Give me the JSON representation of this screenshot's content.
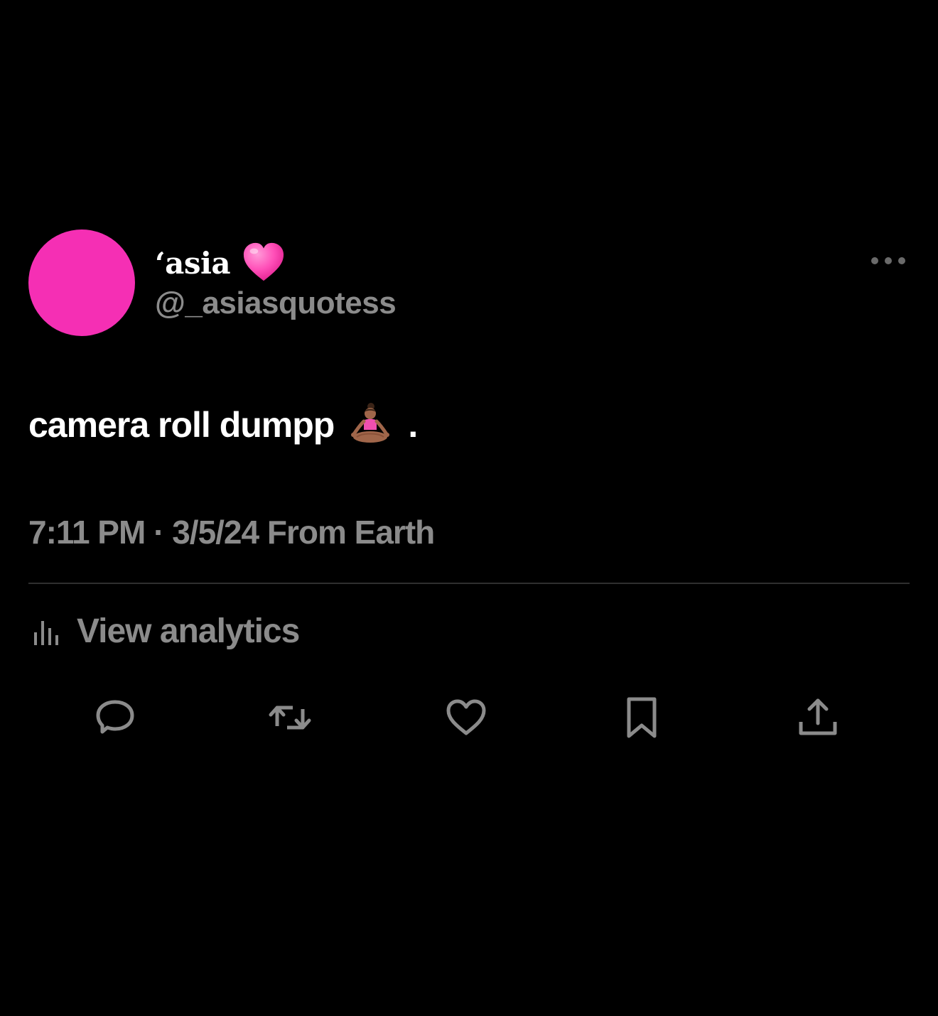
{
  "user": {
    "display_name": "‘asia",
    "name_emoji": "pink-heart-icon",
    "handle": "@_asiasquotess",
    "avatar_color": "#f52fb4"
  },
  "tweet": {
    "text": "camera roll dumpp",
    "emoji": "person-in-lotus-position-icon",
    "trailing": ".",
    "time": "7:11 PM",
    "separator": "·",
    "date": "3/5/24",
    "source": "From Earth"
  },
  "analytics": {
    "label": "View analytics",
    "icon": "analytics-bar-icon"
  },
  "actions": [
    {
      "name": "reply",
      "icon": "comment-bubble-icon"
    },
    {
      "name": "retweet",
      "icon": "retweet-icon"
    },
    {
      "name": "like",
      "icon": "heart-icon"
    },
    {
      "name": "bookmark",
      "icon": "bookmark-icon"
    },
    {
      "name": "share",
      "icon": "share-upload-icon"
    }
  ],
  "colors": {
    "background": "#000000",
    "primary_text": "#ffffff",
    "secondary_text": "#8b8b8b",
    "icon_gray": "#8b8b8b",
    "accent_pink": "#f52fb4"
  }
}
